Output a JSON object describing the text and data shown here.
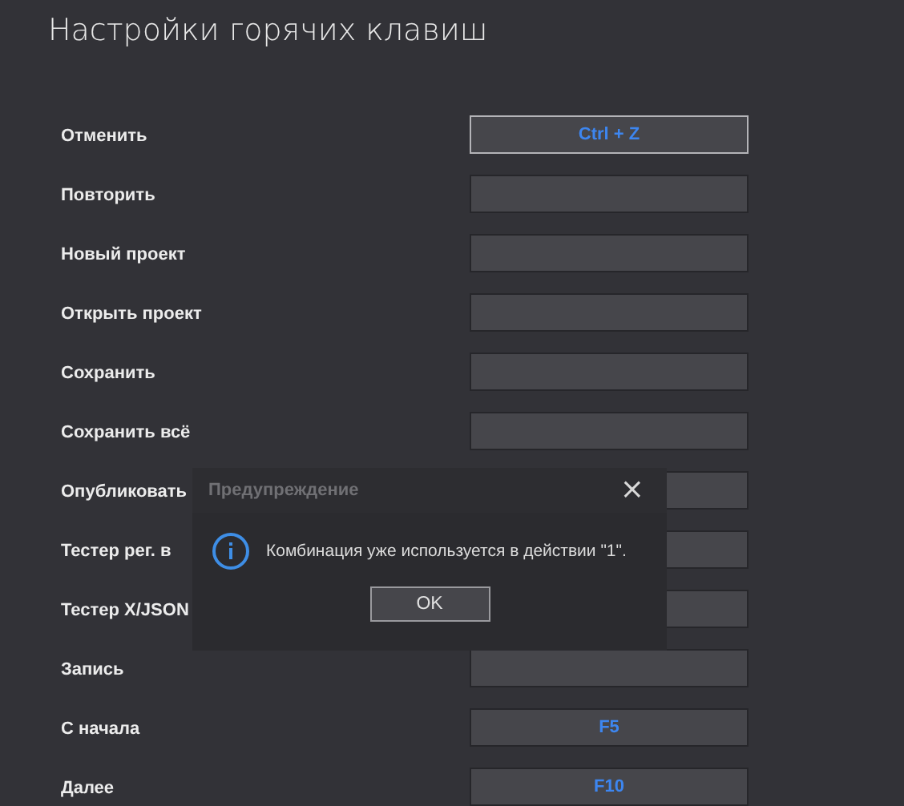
{
  "page": {
    "title": "Настройки горячих клавиш"
  },
  "shortcuts": [
    {
      "label": "Отменить",
      "value": "Ctrl + Z",
      "focused": true
    },
    {
      "label": "Повторить",
      "focused": false
    },
    {
      "label": "Новый проект",
      "focused": false
    },
    {
      "label": "Открыть проект",
      "focused": false
    },
    {
      "label": "Сохранить",
      "focused": false
    },
    {
      "label": "Сохранить всё",
      "focused": false
    },
    {
      "label": "Опубликовать",
      "focused": false
    },
    {
      "label": "Тестер рег. в",
      "focused": false
    },
    {
      "label": "Тестер X/JSON",
      "focused": false
    },
    {
      "label": "Запись",
      "focused": false
    },
    {
      "label": "С начала",
      "value": "F5",
      "focused": false
    },
    {
      "label": "Далее",
      "value": "F10",
      "focused": false
    }
  ],
  "dialog": {
    "title": "Предупреждение",
    "close": "×",
    "message": "Комбинация уже используется в действии \"1\".",
    "button": "OK"
  }
}
